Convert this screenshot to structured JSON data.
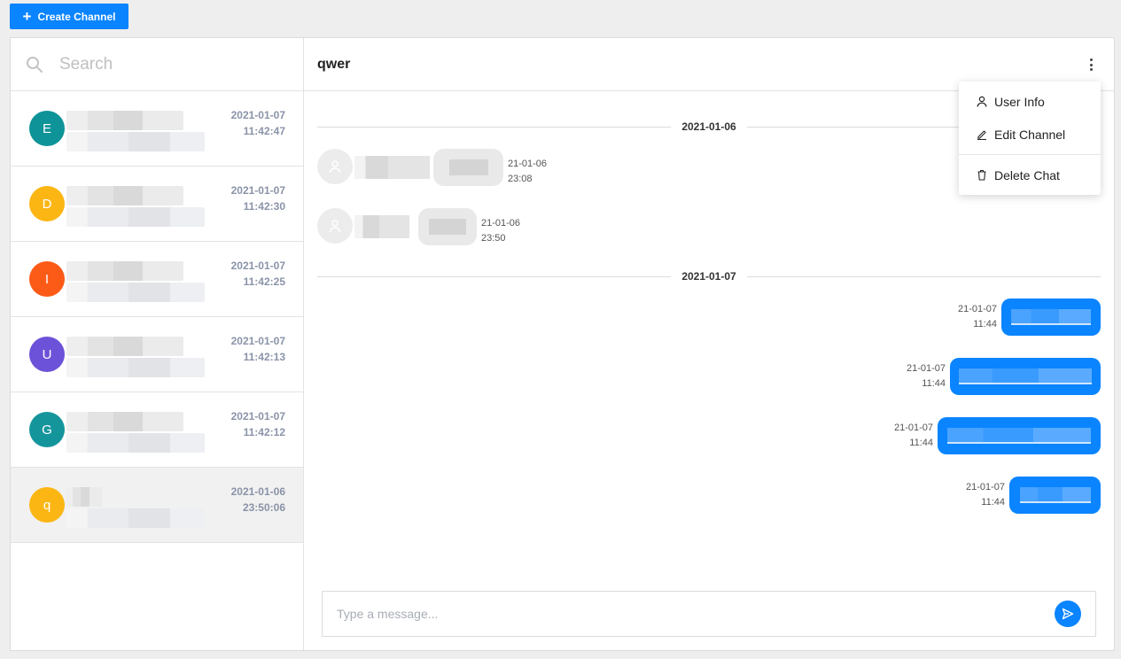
{
  "toolbar": {
    "create_channel_label": "Create Channel"
  },
  "search": {
    "placeholder": "Search"
  },
  "channels": [
    {
      "initial": "E",
      "color": "#0d9398",
      "date": "2021-01-07",
      "time": "11:42:47"
    },
    {
      "initial": "D",
      "color": "#fbb614",
      "date": "2021-01-07",
      "time": "11:42:30"
    },
    {
      "initial": "I",
      "color": "#fc5a17",
      "date": "2021-01-07",
      "time": "11:42:25"
    },
    {
      "initial": "U",
      "color": "#6c52d8",
      "date": "2021-01-07",
      "time": "11:42:13"
    },
    {
      "initial": "G",
      "color": "#14959c",
      "date": "2021-01-07",
      "time": "11:42:12"
    },
    {
      "initial": "q",
      "color": "#fbb614",
      "date": "2021-01-06",
      "time": "23:50:06",
      "active": true
    }
  ],
  "chat": {
    "title": "qwer",
    "groups": [
      {
        "date": "2021-01-06",
        "messages": [
          {
            "direction": "in",
            "date": "21-01-06",
            "time": "23:08"
          },
          {
            "direction": "in",
            "date": "21-01-06",
            "time": "23:50"
          }
        ]
      },
      {
        "date": "2021-01-07",
        "messages": [
          {
            "direction": "out",
            "date": "21-01-07",
            "time": "11:44"
          },
          {
            "direction": "out",
            "date": "21-01-07",
            "time": "11:44"
          },
          {
            "direction": "out",
            "date": "21-01-07",
            "time": "11:44"
          },
          {
            "direction": "out",
            "date": "21-01-07",
            "time": "11:44"
          }
        ]
      }
    ]
  },
  "composer": {
    "placeholder": "Type a message..."
  },
  "menu": {
    "user_info": "User Info",
    "edit_channel": "Edit Channel",
    "delete_chat": "Delete Chat"
  },
  "icons": [
    "plus-icon",
    "search-icon",
    "kebab-menu-icon",
    "user-icon",
    "pencil-icon",
    "trash-icon",
    "send-icon"
  ],
  "colors": {
    "accent": "#0a84ff",
    "timestamp": "#8a93a8"
  }
}
